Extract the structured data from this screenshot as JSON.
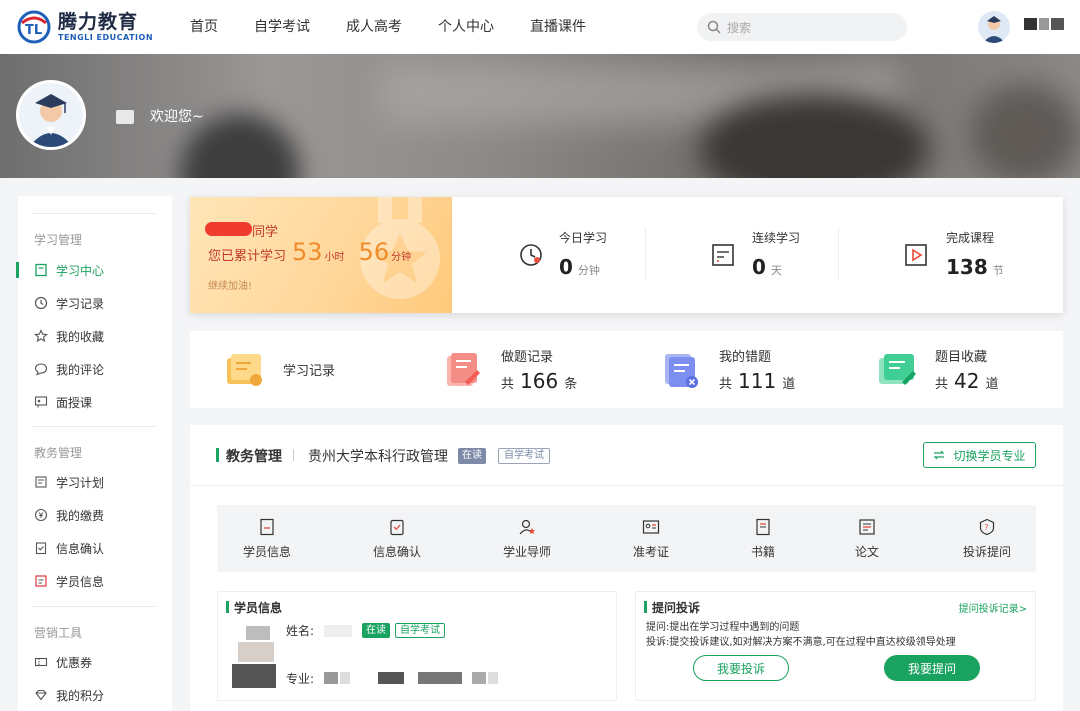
{
  "header": {
    "logo_cn": "腾力教育",
    "logo_en": "TENGLI EDUCATION",
    "nav": [
      "首页",
      "自学考试",
      "成人高考",
      "个人中心",
      "直播课件"
    ],
    "search_placeholder": "搜索"
  },
  "banner": {
    "welcome": "欢迎您~"
  },
  "sidebar": {
    "groups": [
      {
        "title": "学习管理",
        "items": [
          "学习中心",
          "学习记录",
          "我的收藏",
          "我的评论",
          "面授课"
        ]
      },
      {
        "title": "教务管理",
        "items": [
          "学习计划",
          "我的缴费",
          "信息确认",
          "学员信息"
        ]
      },
      {
        "title": "营销工具",
        "items": [
          "优惠券",
          "我的积分"
        ]
      }
    ],
    "active": "学习中心"
  },
  "stats": {
    "classmate": "同学",
    "total_label": "您已累计学习",
    "hours": "53",
    "hours_unit": "小时",
    "minutes": "56",
    "minutes_unit": "分钟",
    "cheer": "继续加油!",
    "cells": [
      {
        "title": "今日学习",
        "value": "0",
        "unit": "分钟",
        "icon": "clock-icon"
      },
      {
        "title": "连续学习",
        "value": "0",
        "unit": "天",
        "icon": "calendar-icon"
      },
      {
        "title": "完成课程",
        "value": "138",
        "unit": "节",
        "icon": "play-icon"
      }
    ]
  },
  "quick": {
    "items": [
      {
        "title": "学习记录",
        "prefix": "",
        "value": "",
        "unit": "",
        "icon": "folder-icon"
      },
      {
        "title": "做题记录",
        "prefix": "共",
        "value": "166",
        "unit": "条",
        "icon": "note-icon"
      },
      {
        "title": "我的错题",
        "prefix": "共",
        "value": "111",
        "unit": "道",
        "icon": "wrong-icon"
      },
      {
        "title": "题目收藏",
        "prefix": "共",
        "value": "42",
        "unit": "道",
        "icon": "favorite-icon"
      }
    ]
  },
  "edu": {
    "title": "教务管理",
    "major": "贵州大学本科行政管理",
    "status_tag": "在读",
    "type_tag": "自学考试",
    "switch_label": "切换学员专业",
    "services": [
      "学员信息",
      "信息确认",
      "学业导师",
      "准考证",
      "书籍",
      "论文",
      "投诉提问"
    ],
    "info_card": {
      "title": "学员信息",
      "name_label": "姓名:",
      "tag1": "在读",
      "tag2": "自学考试",
      "major_label": "专业:"
    },
    "complaint_card": {
      "title": "提问投诉",
      "link": "提问投诉记录>",
      "line1": "提问:提出在学习过程中遇到的问题",
      "line2": "投诉:提交投诉建议,如对解决方案不满意,可在过程中直达校级领导处理",
      "btn_complain": "我要投诉",
      "btn_ask": "我要提问"
    }
  },
  "colors": {
    "accent": "#1aa260",
    "orange": "#f08c2a",
    "red": "#c0392b"
  }
}
